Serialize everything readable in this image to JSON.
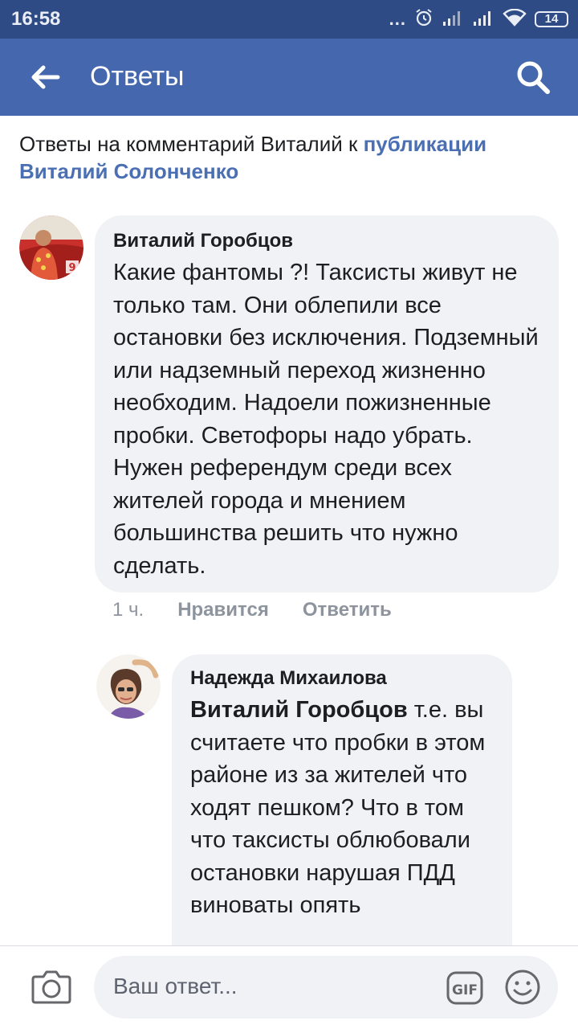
{
  "status_bar": {
    "time": "16:58",
    "dots": "...",
    "battery": "14"
  },
  "app_bar": {
    "title": "Ответы"
  },
  "intro": {
    "prefix": "Ответы на комментарий Виталий к ",
    "link": "публикации Виталий Солонченко"
  },
  "comments": [
    {
      "author": "Виталий Горобцов",
      "text": "Какие фантомы ?! Таксисты живут не только там. Они облепили все остановки без исключения. Подземный или надземный переход жизненно необходим. Надоели пожизненные пробки. Светофоры надо убрать. Нужен референдум среди всех жителей города и мнением большинства решить что нужно сделать.",
      "time": "1 ч.",
      "like_label": "Нравится",
      "reply_label": "Ответить"
    },
    {
      "author": "Надежда Михаилова",
      "mention": "Виталий Горобцов",
      "text": " т.е. вы считаете что пробки в этом районе из за жителей что ходят пешком? Что в том что таксисты облюбовали остановки нарушая ПДД виноваты опять"
    }
  ],
  "compose": {
    "placeholder": "Ваш ответ...",
    "gif_label": "GIF"
  },
  "colors": {
    "status_bar": "#2f4b86",
    "app_bar": "#4467ad",
    "link": "#4b6fb3",
    "bubble": "#f1f2f6",
    "muted": "#8d949e"
  },
  "icons": [
    "back-arrow-icon",
    "search-icon",
    "camera-icon",
    "gif-icon",
    "emoji-icon",
    "alarm-icon",
    "signal-icon",
    "wifi-icon",
    "battery-icon"
  ]
}
